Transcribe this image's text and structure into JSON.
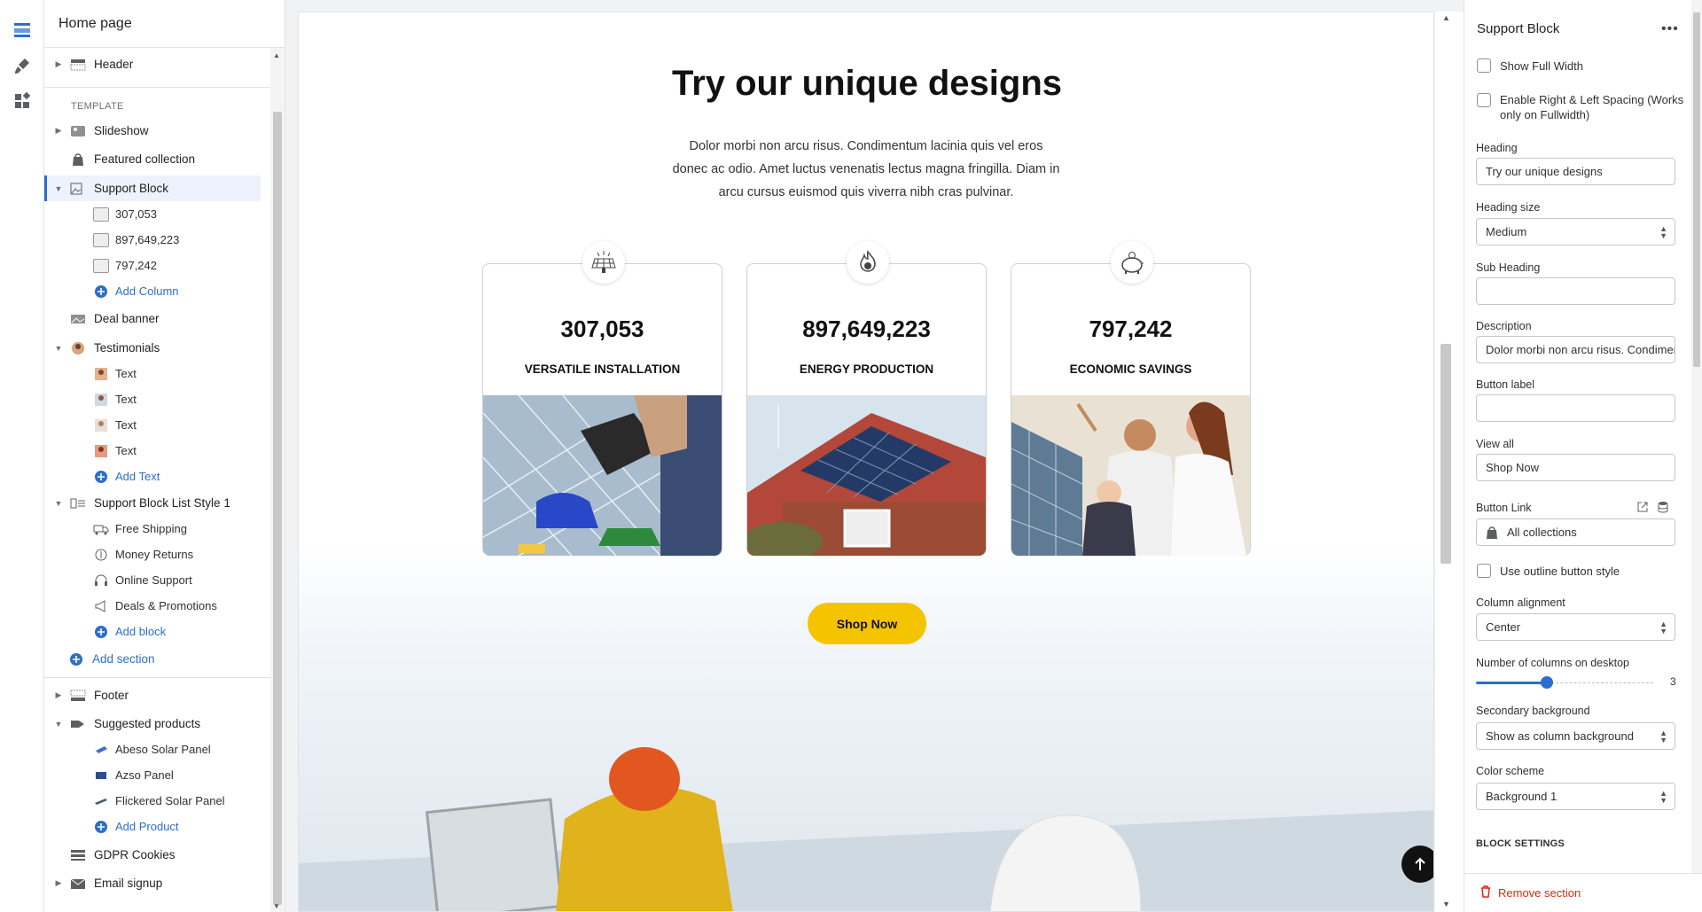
{
  "app": {
    "page_selector": "Home page"
  },
  "sidebar": {
    "template_label": "TEMPLATE",
    "header": "Header",
    "slideshow": "Slideshow",
    "featured_collection": "Featured collection",
    "support_block": "Support Block",
    "support_children": [
      "307,053",
      "897,649,223",
      "797,242"
    ],
    "add_column": "Add Column",
    "deal_banner": "Deal banner",
    "testimonials": "Testimonials",
    "testimonial_children": [
      "Text",
      "Text",
      "Text",
      "Text"
    ],
    "add_text": "Add Text",
    "support_list": "Support Block List Style 1",
    "support_list_children": [
      "Free Shipping",
      "Money Returns",
      "Online Support",
      "Deals & Promotions"
    ],
    "add_block": "Add block",
    "add_section": "Add section",
    "footer": "Footer",
    "suggested_products": "Suggested products",
    "suggested_children": [
      "Abeso Solar Panel",
      "Azso Panel",
      "Flickered Solar Panel"
    ],
    "add_product": "Add Product",
    "gdpr": "GDPR Cookies",
    "email_signup": "Email signup"
  },
  "preview": {
    "heading": "Try our unique designs",
    "description": "Dolor morbi non arcu risus. Condimentum lacinia quis vel eros donec ac odio. Amet luctus venenatis lectus magna fringilla. Diam in arcu cursus euismod quis viverra nibh cras pulvinar.",
    "cards": [
      {
        "number": "307,053",
        "title": "VERSATILE INSTALLATION",
        "icon": "solar-panel-icon"
      },
      {
        "number": "897,649,223",
        "title": "ENERGY PRODUCTION",
        "icon": "energy-flame-icon"
      },
      {
        "number": "797,242",
        "title": "ECONOMIC SAVINGS",
        "icon": "piggy-bank-icon"
      }
    ],
    "button": "Shop Now"
  },
  "panel": {
    "title": "Support Block",
    "more": "•••",
    "show_full_width": "Show Full Width",
    "enable_spacing": "Enable Right & Left Spacing (Works only on Fullwidth)",
    "heading_label": "Heading",
    "heading_value": "Try our unique designs",
    "heading_size_label": "Heading size",
    "heading_size_value": "Medium",
    "sub_heading_label": "Sub Heading",
    "sub_heading_value": "",
    "description_label": "Description",
    "description_value": "Dolor morbi non arcu risus. Condimentum",
    "button_label_label": "Button label",
    "button_label_value": "",
    "view_all_label": "View all",
    "view_all_value": "Shop Now",
    "button_link_label": "Button Link",
    "button_link_value": "All collections",
    "outline_style": "Use outline button style",
    "column_alignment_label": "Column alignment",
    "column_alignment_value": "Center",
    "columns_label": "Number of columns on desktop",
    "columns_value": "3",
    "secondary_bg_label": "Secondary background",
    "secondary_bg_value": "Show as column background",
    "color_scheme_label": "Color scheme",
    "color_scheme_value": "Background 1",
    "block_settings": "BLOCK SETTINGS",
    "remove_section": "Remove section"
  },
  "colors": {
    "accent": "#2c6ecb",
    "shop_button": "#f5c400",
    "danger": "#d72c0d"
  }
}
